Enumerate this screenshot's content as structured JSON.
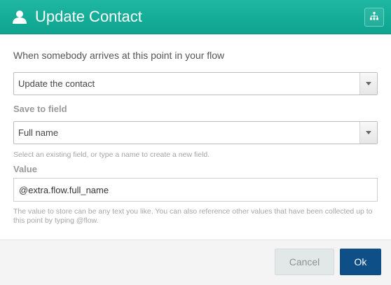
{
  "dialog": {
    "title": "Update Contact",
    "header_icon": "user-icon",
    "flow_icon": "sitemap-icon",
    "accent_color": "#14ac96"
  },
  "action": {
    "intro": "When somebody arrives at this point in your flow",
    "selected": "Update the contact"
  },
  "field": {
    "label": "Save to field",
    "selected": "Full name",
    "help": "Select an existing field, or type a name to create a new field."
  },
  "value": {
    "label": "Value",
    "input_value": "@extra.flow.full_name",
    "help": "The value to store can be any text you like. You can also reference other values that have been collected up to this point by typing @flow."
  },
  "footer": {
    "cancel_label": "Cancel",
    "ok_label": "Ok",
    "ok_color": "#0d4f86"
  }
}
